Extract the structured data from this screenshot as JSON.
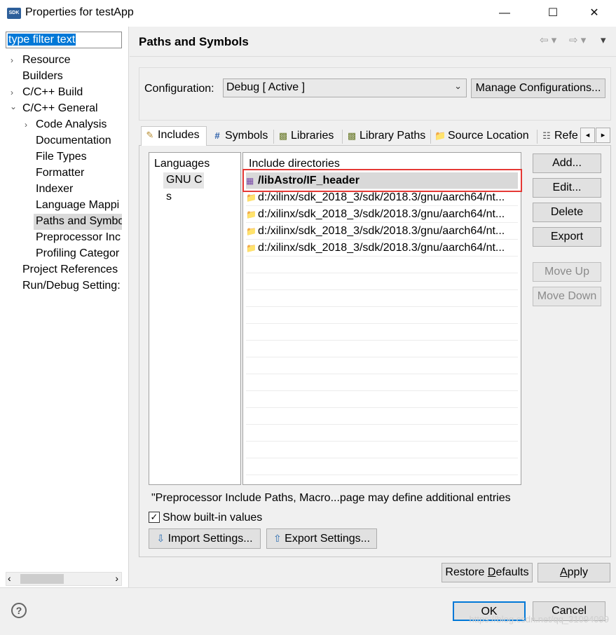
{
  "window": {
    "icon_text": "SDK",
    "title": "Properties for testApp",
    "minimize": "—",
    "maximize": "☐",
    "close": "✕"
  },
  "nav": {
    "filter_text": "type filter text",
    "items": [
      {
        "label": "Resource",
        "arrow": "›"
      },
      {
        "label": "Builders",
        "arrow": ""
      },
      {
        "label": "C/C++ Build",
        "arrow": "›"
      },
      {
        "label": "C/C++ General",
        "arrow": "⌄"
      },
      {
        "label": "Code Analysis",
        "arrow": "›"
      },
      {
        "label": "Documentation",
        "arrow": ""
      },
      {
        "label": "File Types",
        "arrow": ""
      },
      {
        "label": "Formatter",
        "arrow": ""
      },
      {
        "label": "Indexer",
        "arrow": ""
      },
      {
        "label": "Language Mappi",
        "arrow": ""
      },
      {
        "label": "Paths and Symbo",
        "arrow": ""
      },
      {
        "label": "Preprocessor Inc",
        "arrow": ""
      },
      {
        "label": "Profiling Categor",
        "arrow": ""
      },
      {
        "label": "Project References",
        "arrow": ""
      },
      {
        "label": "Run/Debug Setting:",
        "arrow": ""
      }
    ],
    "scroll_left": "‹",
    "scroll_right": "›"
  },
  "header": {
    "title": "Paths and Symbols",
    "back": "⇦ ▾",
    "forward": "⇨ ▾",
    "menu": "▾"
  },
  "config": {
    "label": "Configuration:",
    "value": "Debug  [ Active ]",
    "manage_button": "Manage Configurations..."
  },
  "tabs": [
    "Includes",
    "Symbols",
    "Libraries",
    "Library Paths",
    "Source Location",
    "Refe"
  ],
  "tab_scroll": {
    "left": "◂",
    "right": "▸"
  },
  "languages": {
    "header": "Languages",
    "items": [
      "GNU C",
      "s"
    ]
  },
  "includes": {
    "header": "Include directories",
    "rows": [
      "/libAstro/IF_header",
      "d:/xilinx/sdk_2018_3/sdk/2018.3/gnu/aarch64/nt...",
      "d:/xilinx/sdk_2018_3/sdk/2018.3/gnu/aarch64/nt...",
      "d:/xilinx/sdk_2018_3/sdk/2018.3/gnu/aarch64/nt...",
      "d:/xilinx/sdk_2018_3/sdk/2018.3/gnu/aarch64/nt..."
    ]
  },
  "side_buttons": {
    "add": "Add...",
    "edit": "Edit...",
    "delete": "Delete",
    "export": "Export",
    "move_up": "Move Up",
    "move_down": "Move Down"
  },
  "note": "\"Preprocessor Include Paths, Macro...page may define additional entries",
  "show_builtin": {
    "label": "Show built-in values",
    "checked": "✓"
  },
  "import_button": "Import Settings...",
  "export_button": "Export Settings...",
  "restore_pre": "Restore ",
  "restore_u": "D",
  "restore_post": "efaults",
  "apply_u": "A",
  "apply_rest": "pply",
  "ok_button": "OK",
  "cancel_button": "Cancel",
  "help": "?",
  "watermark": "https://blog.csdn.net/qq_31094099"
}
